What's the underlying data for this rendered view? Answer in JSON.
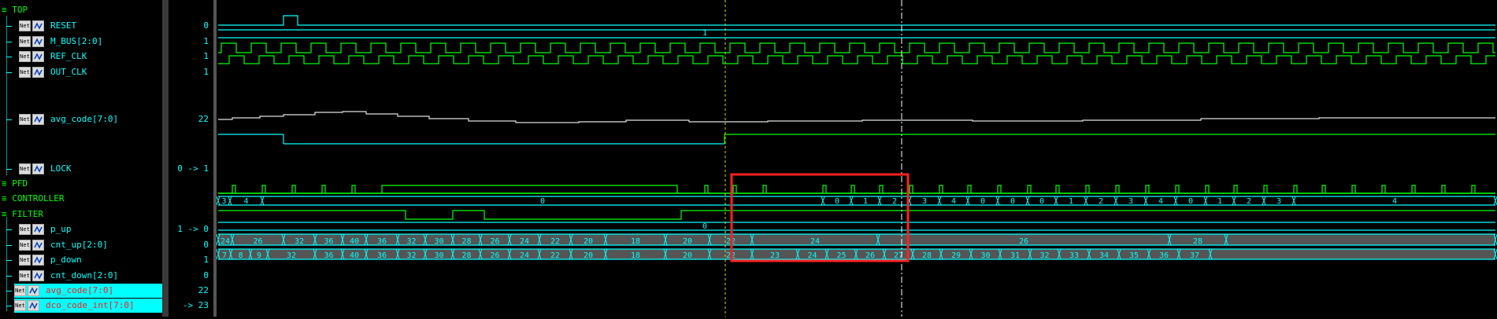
{
  "colors": {
    "signal": "#00ffff",
    "group": "#00ff00",
    "highlight": "#00ffff",
    "marker_box": "#ff2020",
    "cursor_yellow": "#d7d700"
  },
  "signals": [
    {
      "kind": "group",
      "name": "TOP",
      "value": ""
    },
    {
      "kind": "signal",
      "name": "RESET",
      "icon": "bit-icon",
      "value": "0"
    },
    {
      "kind": "signal",
      "name": "M_BUS[2:0]",
      "icon": "bus-input-icon",
      "value": "1"
    },
    {
      "kind": "signal",
      "name": "REF_CLK",
      "icon": "bit-icon",
      "value": "1"
    },
    {
      "kind": "signal",
      "name": "OUT_CLK",
      "icon": "bus-input-icon",
      "value": "1"
    },
    {
      "kind": "signal",
      "name": "avg_code[7:0]",
      "icon": "analog-icon",
      "value": "22"
    },
    {
      "kind": "signal",
      "name": "LOCK",
      "icon": "bit-icon",
      "value": "0 -> 1"
    },
    {
      "kind": "group",
      "name": "PFD",
      "value": ""
    },
    {
      "kind": "group",
      "name": "CONTROLLER",
      "value": ""
    },
    {
      "kind": "group",
      "name": "FILTER",
      "value": ""
    },
    {
      "kind": "signal",
      "name": "p_up",
      "icon": "bus-input-icon",
      "value": "1 -> 0"
    },
    {
      "kind": "signal",
      "name": "cnt_up[2:0]",
      "icon": "reg-icon",
      "value": "0"
    },
    {
      "kind": "signal",
      "name": "p_down",
      "icon": "bus-input-icon",
      "value": "1"
    },
    {
      "kind": "signal",
      "name": "cnt_down[2:0]",
      "icon": "reg-icon",
      "value": "0"
    },
    {
      "kind": "signal",
      "name": "avg_code[7:0]",
      "icon": "reg-icon",
      "value": "22",
      "highlight": true
    },
    {
      "kind": "signal",
      "name": "dco_code_int[7:0]",
      "icon": "reg-icon",
      "value": "-> 23",
      "highlight": true
    }
  ],
  "waves": {
    "m_bus_label": "1",
    "cnt_down_label": "0",
    "cnt_up": [
      "3",
      "4",
      "0",
      "1",
      "2",
      "3",
      "4",
      "0",
      "1",
      "2",
      "3",
      "4",
      "0",
      "1",
      "2",
      "3",
      "4",
      "0"
    ],
    "avg_code": [
      "24",
      "26",
      "32",
      "36",
      "40",
      "36",
      "32",
      "30",
      "28",
      "26",
      "24",
      "22",
      "20",
      "18",
      "20",
      "22",
      "24",
      "26",
      "28"
    ],
    "dco_code_int": [
      "7",
      "8",
      "9",
      "32",
      "36",
      "40",
      "36",
      "32",
      "30",
      "28",
      "26",
      "24",
      "22",
      "20",
      "18",
      "20",
      "22",
      "23",
      "24",
      "25",
      "26",
      "27",
      "28",
      "29",
      "30",
      "31",
      "32",
      "33",
      "34",
      "35",
      "36",
      "37"
    ]
  }
}
